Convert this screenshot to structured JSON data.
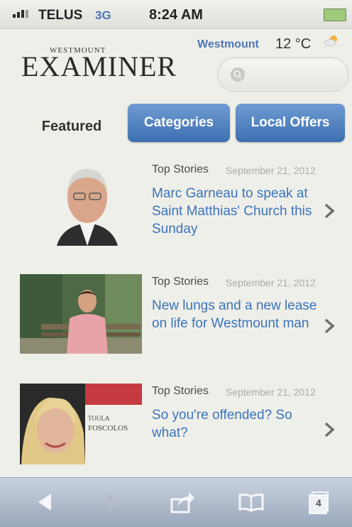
{
  "status": {
    "carrier": "TELUS",
    "network": "3G",
    "time": "8:24 AM"
  },
  "masthead": {
    "logo_top": "WESTMOUNT",
    "logo_main": "EXAMINER",
    "city": "Westmount",
    "temperature": "12 °C",
    "weather_icon": "partly-sunny-icon"
  },
  "tabs": {
    "featured": "Featured",
    "categories": "Categories",
    "local_offers": "Local Offers"
  },
  "articles": [
    {
      "section": "Top Stories",
      "date": "September 21, 2012",
      "headline": "Marc Garneau to speak at Saint Matthias' Church this Sunday"
    },
    {
      "section": "Top Stories",
      "date": "September 21, 2012",
      "headline": "New lungs and a new lease on life for Westmount man"
    },
    {
      "section": "Top Stories",
      "date": "September 21, 2012",
      "headline": "So you're offended? So what?",
      "thumb_caption": "TOULA FOSCOLOS"
    }
  ],
  "toolbar": {
    "tabs_count": "4"
  },
  "colors": {
    "accent": "#3d6fb2",
    "link": "#3a74bd",
    "toolbar": "#9aa7bb"
  }
}
